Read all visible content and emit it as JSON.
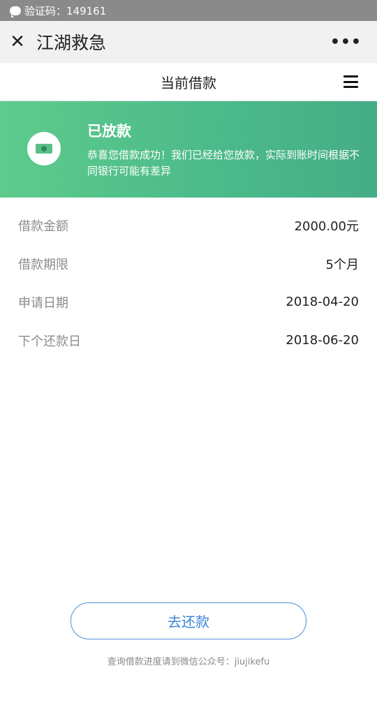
{
  "notification": {
    "icon": "message-bubble-icon",
    "text": "验证码：149161"
  },
  "titlebar": {
    "close_icon": "close-icon",
    "title": "江湖救急",
    "more_icon": "more-dots-icon",
    "more_glyph": "•••"
  },
  "subheader": {
    "title": "当前借款",
    "menu_icon": "hamburger-menu-icon"
  },
  "status_banner": {
    "icon": "cash-icon",
    "title": "已放款",
    "message": "恭喜您借款成功！我们已经给您放款，实际到账时间根据不同银行可能有差异",
    "gradient_start": "#5ecb8c",
    "gradient_end": "#45ad86"
  },
  "details": [
    {
      "label": "借款金额",
      "value": "2000.00元"
    },
    {
      "label": "借款期限",
      "value": "5个月"
    },
    {
      "label": "申请日期",
      "value": "2018-04-20"
    },
    {
      "label": "下个还款日",
      "value": "2018-06-20"
    }
  ],
  "repay_button": {
    "label": "去还款",
    "color": "#3d85d6"
  },
  "footer": {
    "text": "查询借款进度请到微信公众号：jiujikefu"
  }
}
